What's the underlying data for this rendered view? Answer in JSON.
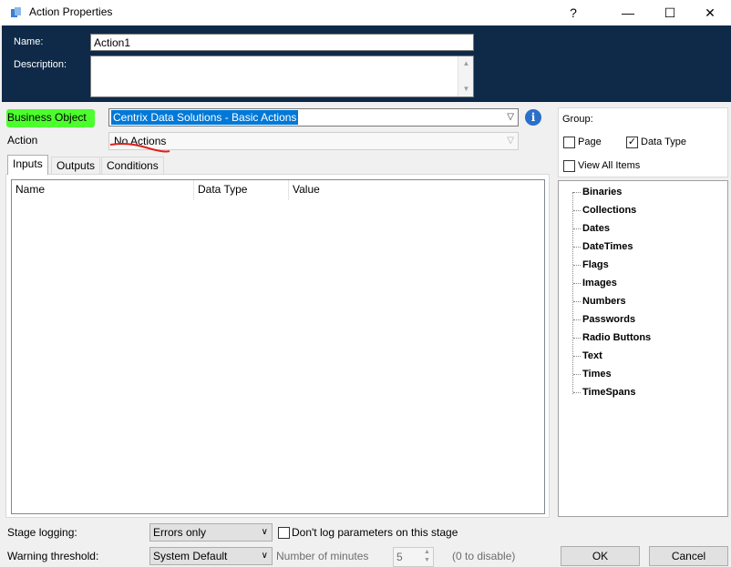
{
  "window": {
    "title": "Action Properties",
    "help_glyph": "?",
    "minimize_glyph": "—",
    "maximize_glyph": "☐",
    "close_glyph": "✕"
  },
  "header": {
    "name_label": "Name:",
    "name_value": "Action1",
    "description_label": "Description:",
    "description_value": ""
  },
  "business_object": {
    "label": "Business Object",
    "selected": "Centrix Data Solutions - Basic Actions"
  },
  "action": {
    "label": "Action",
    "selected": "No Actions"
  },
  "tabs": [
    {
      "label": "Inputs",
      "active": true
    },
    {
      "label": "Outputs",
      "active": false
    },
    {
      "label": "Conditions",
      "active": false
    }
  ],
  "inputs_table": {
    "columns": [
      "Name",
      "Data Type",
      "Value"
    ],
    "rows": []
  },
  "group": {
    "label": "Group:",
    "page_label": "Page",
    "page_checked": false,
    "data_type_label": "Data Type",
    "data_type_checked": true,
    "view_all_label": "View All Items",
    "view_all_checked": false,
    "checkmark": "✓"
  },
  "data_types": [
    "Binaries",
    "Collections",
    "Dates",
    "DateTimes",
    "Flags",
    "Images",
    "Numbers",
    "Passwords",
    "Radio Buttons",
    "Text",
    "Times",
    "TimeSpans"
  ],
  "stage_logging": {
    "label": "Stage logging:",
    "selected": "Errors only",
    "dont_log_label": "Don't log parameters on this stage",
    "dont_log_checked": false
  },
  "warning_threshold": {
    "label": "Warning threshold:",
    "selected": "System Default",
    "minutes_label": "Number of minutes",
    "minutes_value": "5",
    "disable_hint": "(0 to disable)"
  },
  "buttons": {
    "ok": "OK",
    "cancel": "Cancel"
  },
  "colors": {
    "header_bg": "#0f2a48",
    "highlight_green": "#4cff2c",
    "selection_blue": "#0078d7",
    "annotation_red": "#e0201c"
  }
}
